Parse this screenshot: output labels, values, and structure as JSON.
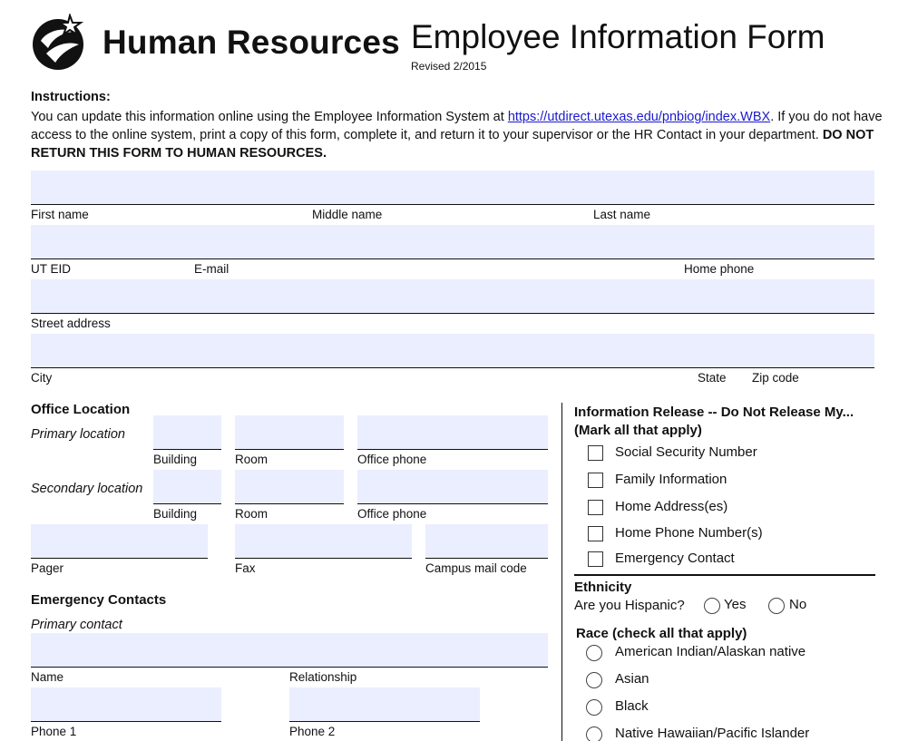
{
  "header": {
    "org_name": "Human Resources",
    "form_title": "Employee Information Form",
    "revised": "Revised 2/2015"
  },
  "instructions": {
    "heading": "Instructions:",
    "text_before_link": "You can update this information online using the Employee Information System at ",
    "link": "https://utdirect.utexas.edu/pnbiog/index.WBX",
    "text_after_link": ". If you do not have access to the online system, print a copy of this form, complete it, and return it to your supervisor or the HR Contact in your department. ",
    "warning": "DO NOT RETURN THIS FORM TO HUMAN RESOURCES."
  },
  "personal": {
    "first_name": "First name",
    "middle_name": "Middle name",
    "last_name": "Last name",
    "ut_eid": "UT EID",
    "email": "E-mail",
    "home_phone": "Home phone",
    "street_address": "Street address",
    "city": "City",
    "state": "State",
    "zip": "Zip code"
  },
  "office": {
    "heading": "Office Location",
    "primary": "Primary location",
    "secondary": "Secondary location",
    "building": "Building",
    "room": "Room",
    "office_phone": "Office phone",
    "pager": "Pager",
    "fax": "Fax",
    "campus_mail": "Campus mail code"
  },
  "emergency": {
    "heading": "Emergency Contacts",
    "primary": "Primary contact",
    "name": "Name",
    "relationship": "Relationship",
    "phone1": "Phone 1",
    "phone2": "Phone 2"
  },
  "release": {
    "heading": "Information Release -- Do Not Release My...",
    "subheading": "(Mark all that apply)",
    "items": [
      "Social Security Number",
      "Family Information",
      "Home Address(es)",
      "Home Phone Number(s)",
      "Emergency Contact"
    ]
  },
  "ethnicity": {
    "heading": "Ethnicity",
    "question": "Are you Hispanic?",
    "yes": "Yes",
    "no": "No"
  },
  "race": {
    "heading": "Race (check all that apply)",
    "items": [
      "American Indian/Alaskan native",
      "Asian",
      "Black",
      "Native Hawaiian/Pacific Islander"
    ]
  },
  "colors": {
    "field_fill": "#eaeefe",
    "link": "#1a1acc"
  }
}
